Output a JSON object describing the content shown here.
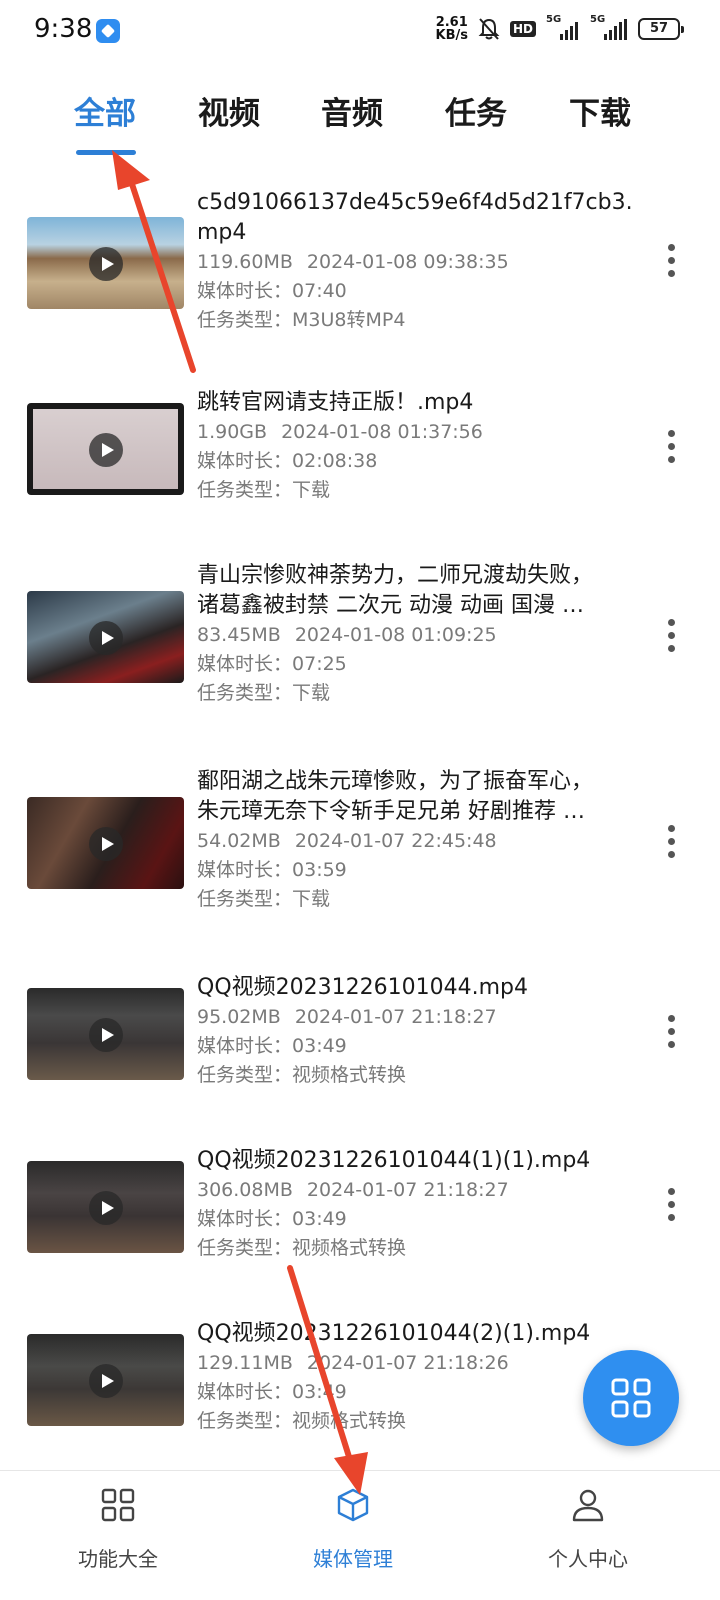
{
  "status_bar": {
    "time": "9:38",
    "net_speed_value": "2.61",
    "net_speed_unit": "KB/s",
    "hd_label": "HD",
    "signal_1_label": "5G",
    "signal_2_label": "5G",
    "battery": "57"
  },
  "tabs": [
    {
      "label": "全部",
      "active": true
    },
    {
      "label": "视频",
      "active": false
    },
    {
      "label": "音频",
      "active": false
    },
    {
      "label": "任务",
      "active": false
    },
    {
      "label": "下载",
      "active": false
    }
  ],
  "media_items": [
    {
      "title_line1": "c5d91066137de45c59e6f4d5d21f7cb3.",
      "title_line2": "mp4",
      "size": "119.60MB",
      "datetime": "2024-01-08 09:38:35",
      "duration_label": "媒体时长：",
      "duration": "07:40",
      "type_label": "任务类型：",
      "type": "M3U8转MP4"
    },
    {
      "title_line1": "跳转官网请支持正版！.mp4",
      "title_line2": "",
      "size": "1.90GB",
      "datetime": "2024-01-08 01:37:56",
      "duration_label": "媒体时长：",
      "duration": "02:08:38",
      "type_label": "任务类型：",
      "type": "下载"
    },
    {
      "title_line1": "青山宗惨败神荼势力，二师兄渡劫失败，",
      "title_line2": "诸葛鑫被封禁 二次元 动漫 动画 国漫 …",
      "size": "83.45MB",
      "datetime": "2024-01-08 01:09:25",
      "duration_label": "媒体时长：",
      "duration": "07:25",
      "type_label": "任务类型：",
      "type": "下载"
    },
    {
      "title_line1": "鄱阳湖之战朱元璋惨败，为了振奋军心，",
      "title_line2": "朱元璋无奈下令斩手足兄弟 好剧推荐 …",
      "size": "54.02MB",
      "datetime": "2024-01-07 22:45:48",
      "duration_label": "媒体时长：",
      "duration": "03:59",
      "type_label": "任务类型：",
      "type": "下载"
    },
    {
      "title_line1": "QQ视频20231226101044.mp4",
      "title_line2": "",
      "size": "95.02MB",
      "datetime": "2024-01-07 21:18:27",
      "duration_label": "媒体时长：",
      "duration": "03:49",
      "type_label": "任务类型：",
      "type": "视频格式转换"
    },
    {
      "title_line1": "QQ视频20231226101044(1)(1).mp4",
      "title_line2": "",
      "size": "306.08MB",
      "datetime": "2024-01-07 21:18:27",
      "duration_label": "媒体时长：",
      "duration": "03:49",
      "type_label": "任务类型：",
      "type": "视频格式转换"
    },
    {
      "title_line1": "QQ视频20231226101044(2)(1).mp4",
      "title_line2": "",
      "size": "129.11MB",
      "datetime": "2024-01-07 21:18:26",
      "duration_label": "媒体时长：",
      "duration": "03:49",
      "type_label": "任务类型：",
      "type": "视频格式转换"
    }
  ],
  "bottom_nav": [
    {
      "label": "功能大全",
      "icon": "grid-icon",
      "active": false
    },
    {
      "label": "媒体管理",
      "icon": "cube-icon",
      "active": true
    },
    {
      "label": "个人中心",
      "icon": "person-icon",
      "active": false
    }
  ],
  "colors": {
    "accent": "#2d7fd6",
    "fab": "#2f8ff0",
    "annotation_arrow": "#e8452c"
  }
}
